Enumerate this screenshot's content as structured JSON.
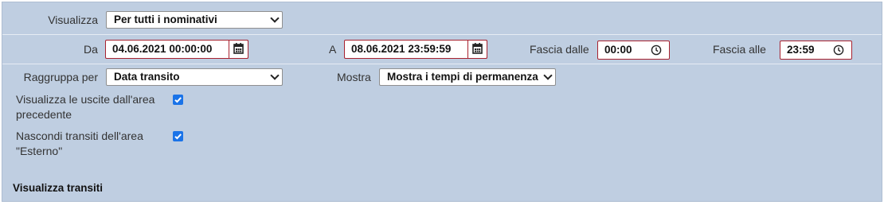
{
  "filters": {
    "visualizza_label": "Visualizza",
    "visualizza_value": "Per tutti i nominativi",
    "da_label": "Da",
    "da_value": "04.06.2021 00:00:00",
    "a_label": "A",
    "a_value": "08.06.2021 23:59:59",
    "fascia_dalle_label": "Fascia dalle",
    "fascia_dalle_value": "00:00",
    "fascia_alle_label": "Fascia alle",
    "fascia_alle_value": "23:59",
    "raggruppa_label": "Raggruppa per",
    "raggruppa_value": "Data transito",
    "mostra_label": "Mostra",
    "mostra_value": "Mostra i tempi di permanenza",
    "uscite_label_line1": "Visualizza le uscite dall'area",
    "uscite_label_line2": "precedente",
    "uscite_checked": true,
    "nascondi_label_line1": "Nascondi transiti dell'area",
    "nascondi_label_line2": "\"Esterno\"",
    "nascondi_checked": true
  },
  "section": {
    "title": "Visualizza transiti"
  },
  "colors": {
    "panel_bg": "#bfcee1",
    "input_border": "#a8222f",
    "checkbox_accent": "#1a73e8"
  }
}
